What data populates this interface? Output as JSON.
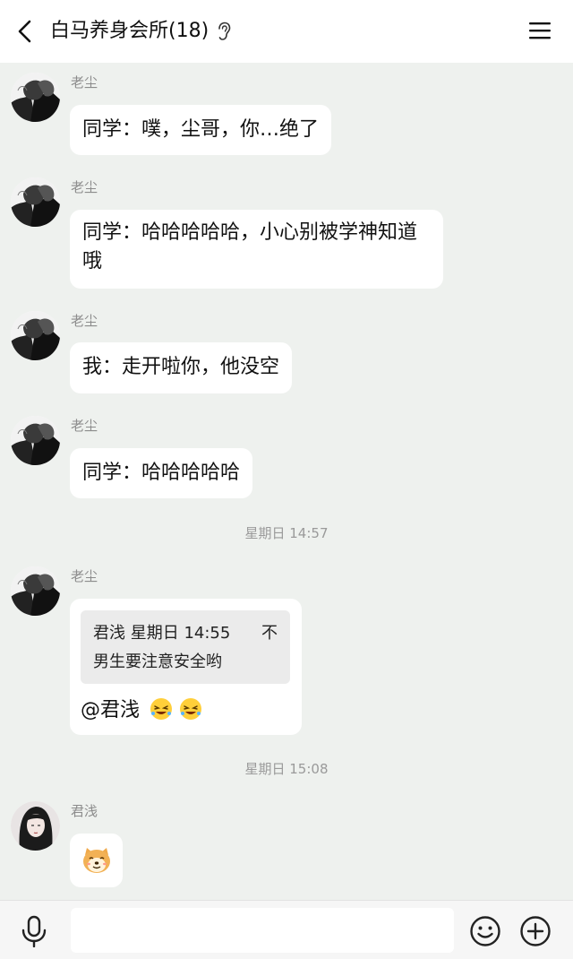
{
  "header": {
    "title": "白马养身会所(18)",
    "back_icon": "chevron-left-icon",
    "ear_icon": "ear-icon",
    "menu_icon": "hamburger-menu-icon"
  },
  "messages": [
    {
      "sender": "老尘",
      "text": "同学：噗，尘哥，你…绝了"
    },
    {
      "sender": "老尘",
      "text": "同学：哈哈哈哈哈，小心别被学神知道哦"
    },
    {
      "sender": "老尘",
      "text": "我：走开啦你，他没空"
    },
    {
      "sender": "老尘",
      "text": "同学：哈哈哈哈哈"
    }
  ],
  "separators": [
    "星期日 14:57",
    "星期日 15:08"
  ],
  "quote_message": {
    "sender": "老尘",
    "quote_header": "君浅 星期日 14:55",
    "quote_close": "不",
    "quote_body": "男生要注意安全哟",
    "reply_text": "@君浅"
  },
  "sticker_message": {
    "sender": "君浅",
    "sticker_icon": "doge-dog-emoji-icon"
  },
  "input_bar": {
    "placeholder": "",
    "mic_icon": "microphone-icon",
    "emoji_icon": "smiley-icon",
    "plus_icon": "plus-circle-icon"
  },
  "colors": {
    "chat_bg": "#eef1ee",
    "bubble": "#ffffff",
    "quote_bg": "#ebebeb",
    "meta_text": "#9a9a9a"
  }
}
